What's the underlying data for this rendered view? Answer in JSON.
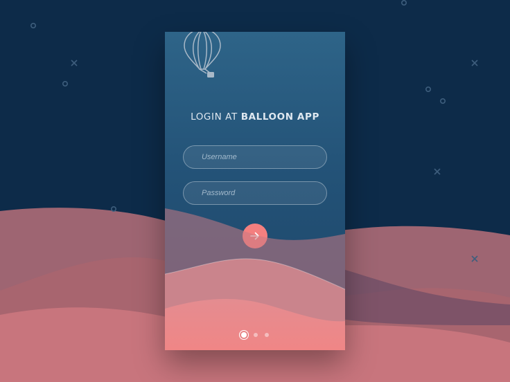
{
  "login": {
    "title_prefix": "LOGIN AT ",
    "title_bold": "BALLOON APP",
    "username_placeholder": "Username",
    "password_placeholder": "Password",
    "submit_icon": "arrow-right-icon"
  },
  "pager": {
    "count": 3,
    "active_index": 0
  },
  "colors": {
    "background": "#0d2b49",
    "card_top": "#2e6488",
    "accent": "#f47f7f",
    "wave": "#d97d83"
  }
}
